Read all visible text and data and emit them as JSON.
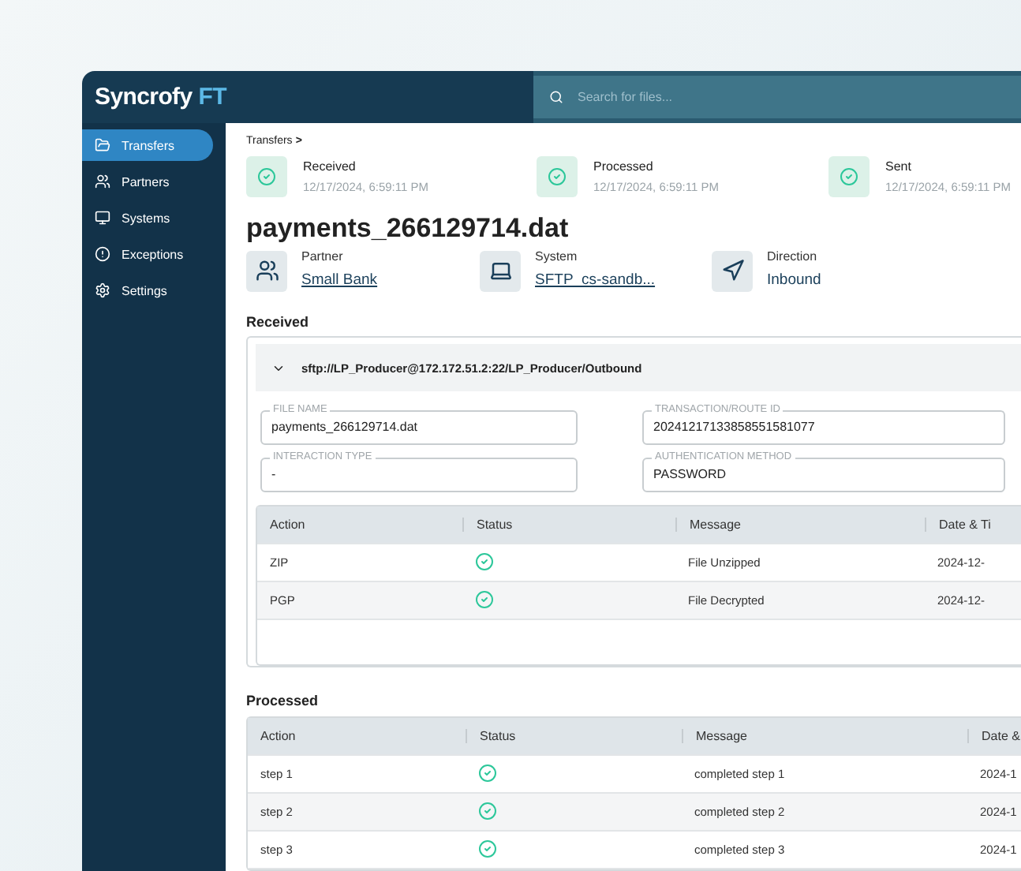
{
  "brand": {
    "name": "Syncrofy",
    "suffix": "FT"
  },
  "search": {
    "placeholder": "Search for files..."
  },
  "sidebar": {
    "items": [
      {
        "label": "Transfers",
        "selected": true
      },
      {
        "label": "Partners",
        "selected": false
      },
      {
        "label": "Systems",
        "selected": false
      },
      {
        "label": "Exceptions",
        "selected": false
      },
      {
        "label": "Settings",
        "selected": false
      }
    ]
  },
  "breadcrumb": {
    "label": "Transfers",
    "separator": ">"
  },
  "stages": [
    {
      "label": "Received",
      "time": "12/17/2024, 6:59:11 PM",
      "done": true
    },
    {
      "label": "Processed",
      "time": "12/17/2024, 6:59:11 PM",
      "done": true
    },
    {
      "label": "Sent",
      "time": "12/17/2024, 6:59:11 PM",
      "done": true
    }
  ],
  "title": "payments_266129714.dat",
  "info": [
    {
      "label": "Partner",
      "value": "Small Bank",
      "link": true
    },
    {
      "label": "System",
      "value": "SFTP_cs-sandb...",
      "link": true
    },
    {
      "label": "Direction",
      "value": "Inbound",
      "link": false
    }
  ],
  "received": {
    "heading": "Received",
    "path": "sftp://LP_Producer@172.172.51.2:22/LP_Producer/Outbound",
    "expanded": true,
    "fields": [
      {
        "label": "FILE NAME",
        "value": "payments_266129714.dat"
      },
      {
        "label": "TRANSACTION/ROUTE ID",
        "value": "20241217133858551581077"
      },
      {
        "label": "INTERACTION TYPE",
        "value": "-"
      },
      {
        "label": "AUTHENTICATION METHOD",
        "value": "PASSWORD"
      }
    ],
    "table": {
      "columns": [
        "Action",
        "Status",
        "Message",
        "Date & Ti"
      ],
      "rows": [
        {
          "action": "ZIP",
          "ok": true,
          "message": "File Unzipped",
          "date": "2024-12-"
        },
        {
          "action": "PGP",
          "ok": true,
          "message": "File Decrypted",
          "date": "2024-12-"
        }
      ]
    }
  },
  "processed": {
    "heading": "Processed",
    "table": {
      "columns": [
        "Action",
        "Status",
        "Message",
        "Date &"
      ],
      "rows": [
        {
          "action": "step 1",
          "ok": true,
          "message": "completed step 1",
          "date": "2024-1"
        },
        {
          "action": "step 2",
          "ok": true,
          "message": "completed step 2",
          "date": "2024-1"
        },
        {
          "action": "step 3",
          "ok": true,
          "message": "completed step 3",
          "date": "2024-1"
        }
      ]
    }
  }
}
